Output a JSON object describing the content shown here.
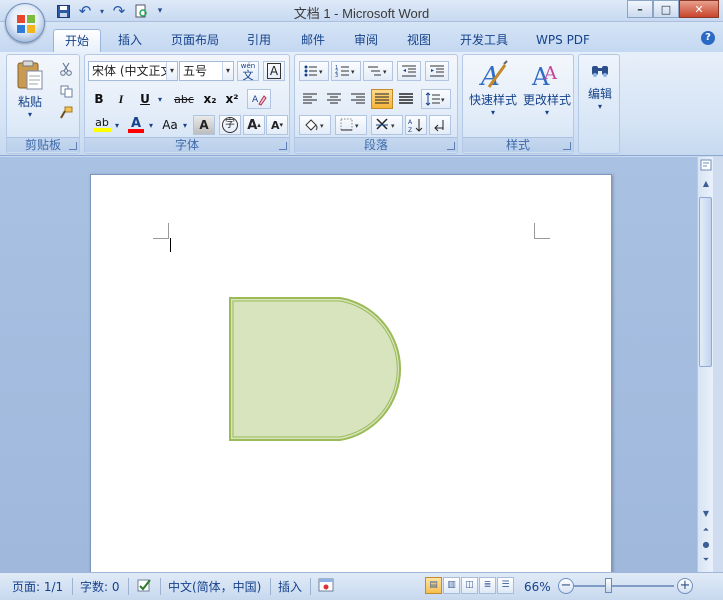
{
  "window": {
    "title": "文档 1 - Microsoft Word",
    "minimize": "–",
    "maximize": "□",
    "close": "✕"
  },
  "quick_access": {
    "save": "💾",
    "undo": "↶",
    "redo": "↷",
    "print_preview": "🗋",
    "customize": "▾"
  },
  "tabs": [
    {
      "label": "开始",
      "active": true
    },
    {
      "label": "插入"
    },
    {
      "label": "页面布局"
    },
    {
      "label": "引用"
    },
    {
      "label": "邮件"
    },
    {
      "label": "审阅"
    },
    {
      "label": "视图"
    },
    {
      "label": "开发工具"
    },
    {
      "label": "WPS PDF"
    }
  ],
  "help": "?",
  "ribbon": {
    "clipboard": {
      "label": "剪贴板",
      "paste": "粘贴"
    },
    "font": {
      "label": "字体",
      "font_name": "宋体 (中文正文)",
      "font_size": "五号",
      "wen": "wén\n文",
      "A_box": "A",
      "bold": "B",
      "italic": "I",
      "underline": "U",
      "strike": "abc",
      "subscript": "x₂",
      "superscript": "x²",
      "highlight": "ab",
      "font_color": "A",
      "change_case": "Aa",
      "char_shading": "A",
      "enclose": "字",
      "grow": "A",
      "shrink": "A"
    },
    "paragraph": {
      "label": "段落"
    },
    "styles": {
      "label": "样式",
      "quick_styles": "快速样式",
      "change_styles": "更改样式"
    },
    "editing": {
      "label": "编辑"
    }
  },
  "status": {
    "page": "页面: 1/1",
    "words": "字数: 0",
    "language": "中文(简体，中国)",
    "mode": "插入",
    "zoom": "66%"
  },
  "colors": {
    "shape_fill": "#d7e4bd",
    "shape_stroke": "#9bbb59",
    "font_color_bar": "#ff0000",
    "highlight_bar": "#ffff00"
  }
}
